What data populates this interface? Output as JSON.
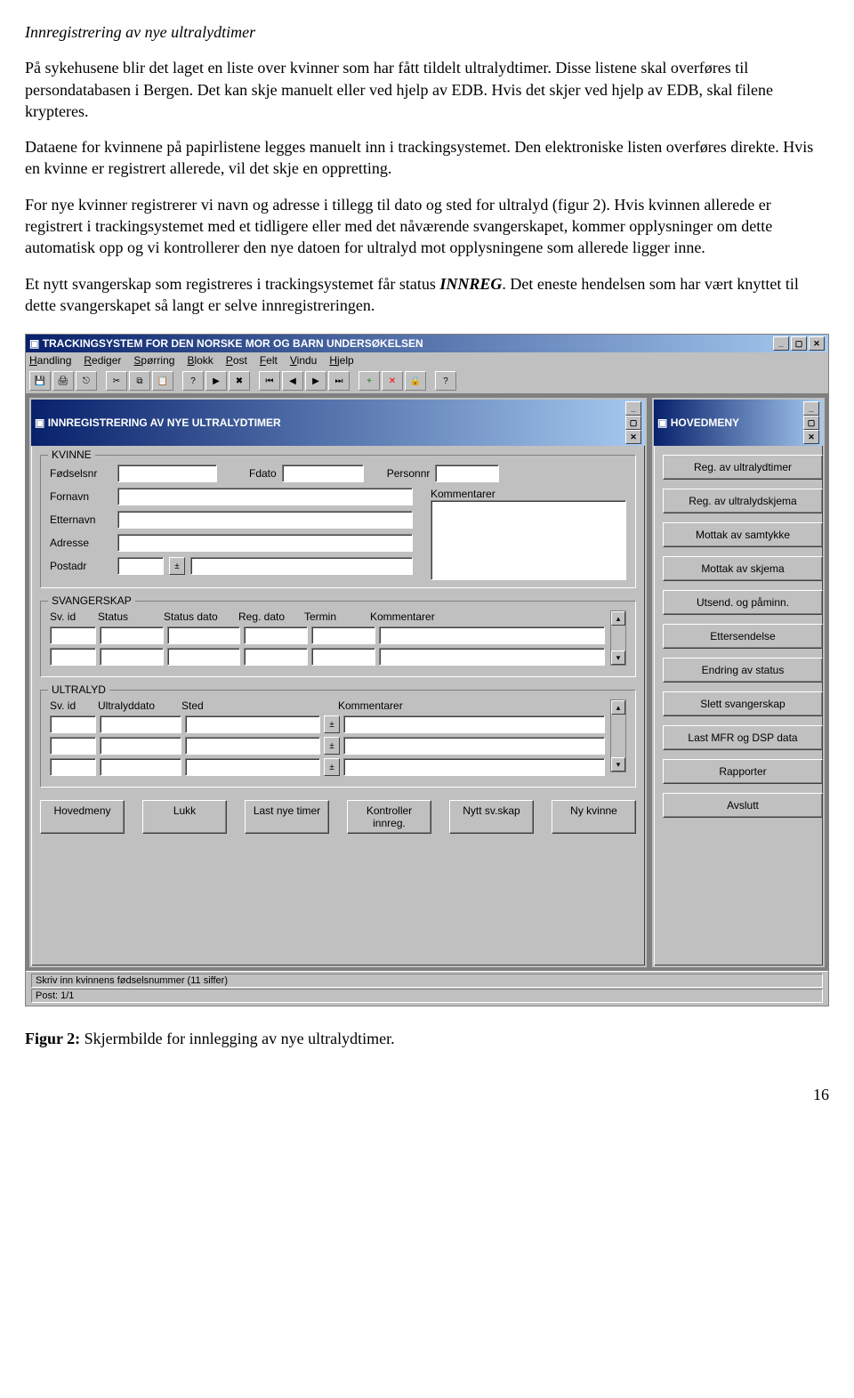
{
  "doc": {
    "heading": "Innregistrering av nye ultralydtimer",
    "p1": "På sykehusene blir det laget en liste over kvinner som har fått tildelt ultralydtimer. Disse listene skal overføres til persondatabasen i Bergen. Det kan skje manuelt eller ved hjelp av EDB. Hvis det skjer ved hjelp av EDB, skal filene krypteres.",
    "p2": "Dataene for kvinnene på papirlistene legges manuelt inn i trackingsystemet. Den elektroniske listen overføres direkte. Hvis en kvinne er registrert allerede, vil det skje en oppretting.",
    "p3": "For nye kvinner registrerer vi navn og adresse i tillegg til dato og sted for ultralyd (figur 2). Hvis kvinnen allerede er registrert i trackingsystemet med et tidligere eller med det nåværende svangerskapet, kommer opplysninger om dette automatisk opp og vi kontrollerer den nye datoen for ultralyd mot opplysningene som allerede ligger inne.",
    "p4a": "Et nytt svangerskap som registreres i trackingsystemet får status ",
    "p4status": "INNREG",
    "p4b": ". Det eneste hendelsen som har vært knyttet til dette svangerskapet så langt er selve innregistreringen.",
    "fig_label": "Figur 2:",
    "fig_text": " Skjermbilde for innlegging av nye ultralydtimer.",
    "pagenum": "16"
  },
  "app": {
    "title": "TRACKINGSYSTEM FOR DEN NORSKE MOR OG BARN UNDERSØKELSEN",
    "menu": [
      "Handling",
      "Rediger",
      "Spørring",
      "Blokk",
      "Post",
      "Felt",
      "Vindu",
      "Hjelp"
    ],
    "status1": "Skriv inn kvinnens fødselsnummer (11 siffer)",
    "status2": "Post: 1/1"
  },
  "form": {
    "title": "INNREGISTRERING AV NYE ULTRALYDTIMER",
    "kvinne": {
      "legend": "KVINNE",
      "fodselsnr": "Fødselsnr",
      "fdato": "Fdato",
      "personnr": "Personnr",
      "fornavn": "Fornavn",
      "etternavn": "Etternavn",
      "adresse": "Adresse",
      "postadr": "Postadr",
      "kommentarer": "Kommentarer"
    },
    "svangerskap": {
      "legend": "SVANGERSKAP",
      "svid": "Sv. id",
      "status": "Status",
      "statusdato": "Status dato",
      "regdato": "Reg. dato",
      "termin": "Termin",
      "kommentarer": "Kommentarer"
    },
    "ultralyd": {
      "legend": "ULTRALYD",
      "svid": "Sv. id",
      "ultralyddato": "Ultralyddato",
      "sted": "Sted",
      "kommentarer": "Kommentarer"
    },
    "buttons": {
      "hovedmeny": "Hovedmeny",
      "lukk": "Lukk",
      "lastnye": "Last nye timer",
      "kontroller": "Kontroller innreg.",
      "nyttsv": "Nytt sv.skap",
      "nykvinne": "Ny kvinne"
    }
  },
  "hovedmeny": {
    "title": "HOVEDMENY",
    "items": [
      "Reg. av ultralydtimer",
      "Reg. av ultralydskjema",
      "Mottak av samtykke",
      "Mottak av skjema",
      "Utsend. og påminn.",
      "Ettersendelse",
      "Endring av status",
      "Slett svangerskap",
      "Last MFR og DSP data",
      "Rapporter",
      "Avslutt"
    ]
  }
}
